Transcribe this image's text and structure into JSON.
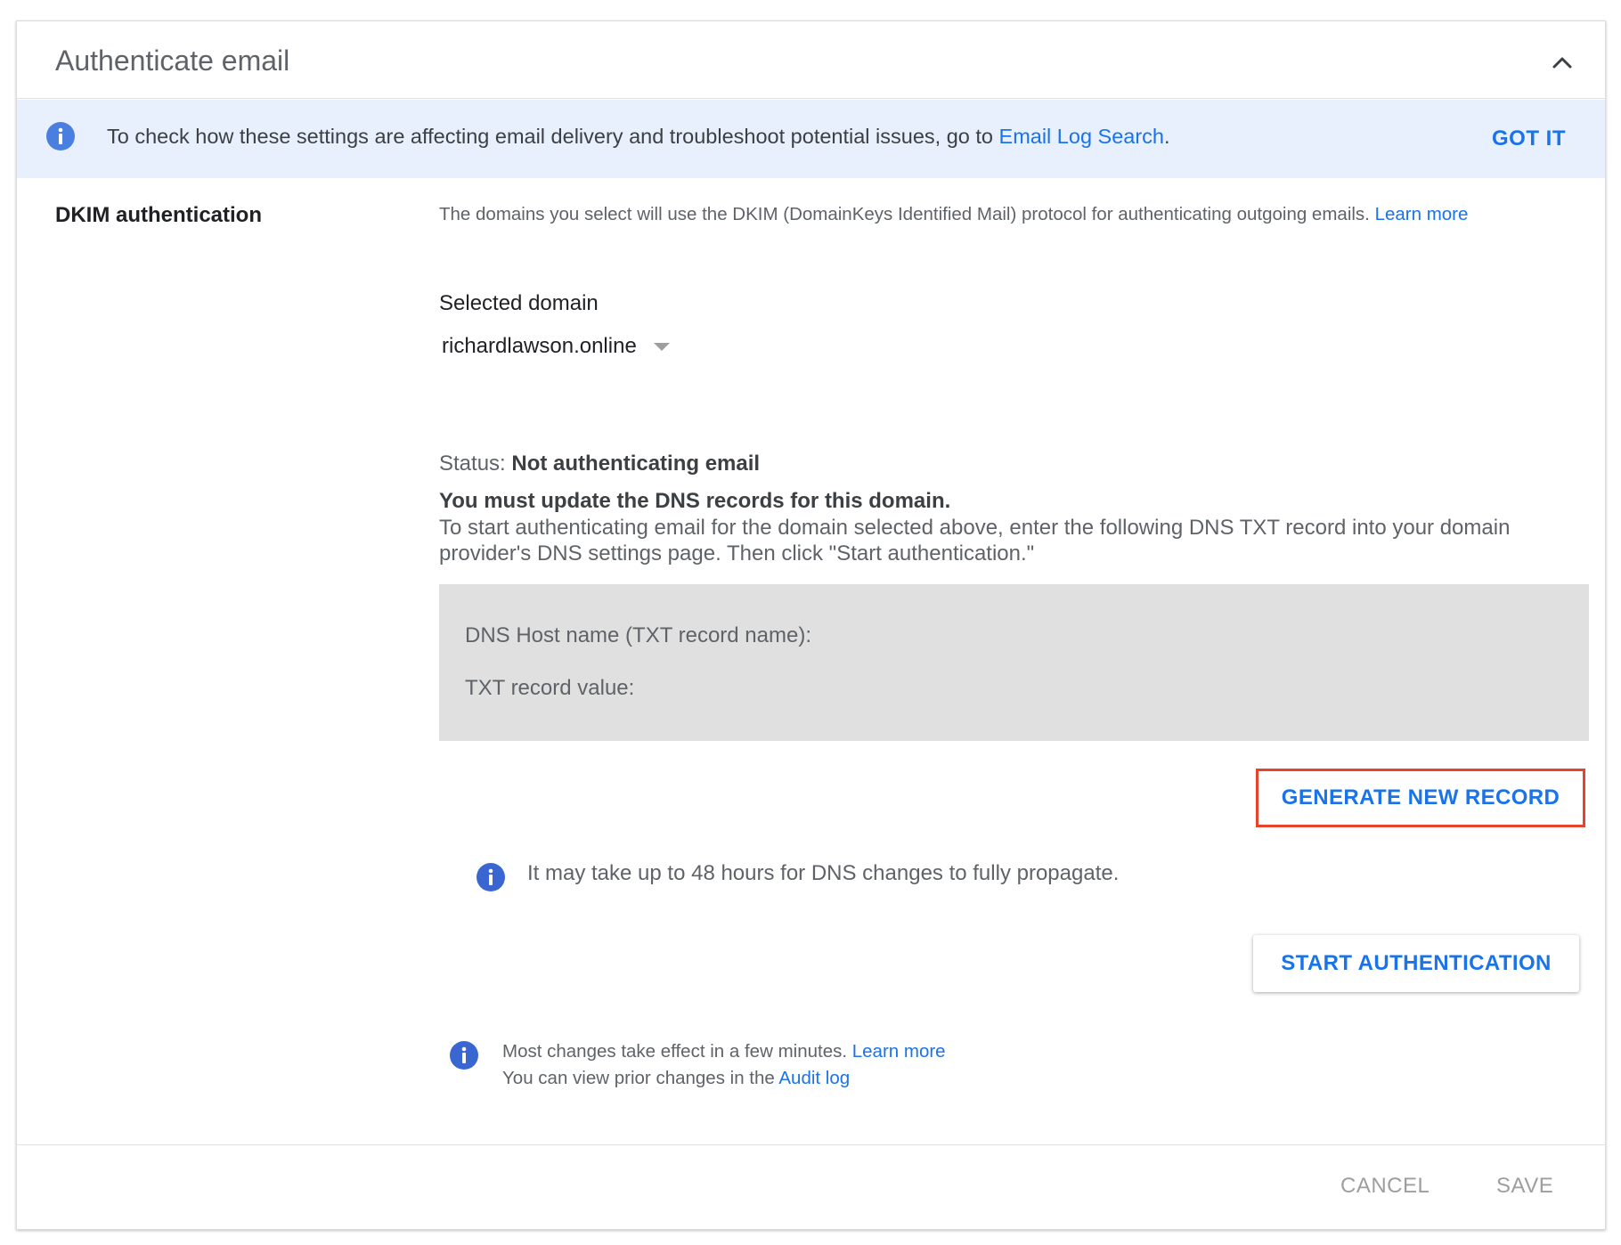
{
  "header": {
    "title": "Authenticate email",
    "collapse_icon": "chevron-up-icon"
  },
  "banner": {
    "icon": "info-icon",
    "text": "To check how these settings are affecting email delivery and troubleshoot potential issues, go to ",
    "link_text": "Email Log Search",
    "text_suffix": ".",
    "dismiss_label": "GOT IT"
  },
  "dkim": {
    "section_label": "DKIM authentication",
    "description": "The domains you select will use the DKIM (DomainKeys Identified Mail) protocol for authenticating outgoing emails. ",
    "learn_more": "Learn more",
    "selected_domain_label": "Selected domain",
    "selected_domain_value": "richardlawson.online",
    "status_prefix": "Status: ",
    "status_value": "Not authenticating email",
    "dns_warning": "You must update the DNS records for this domain.",
    "dns_instructions": "To start authenticating email for the domain selected above, enter the following DNS TXT record into your domain provider's DNS settings page. Then click \"Start authentication.\"",
    "record_host_label": "DNS Host name (TXT record name):",
    "record_value_label": "TXT record value:",
    "generate_button": "GENERATE NEW RECORD",
    "propagate_note": "It may take up to 48 hours for DNS changes to fully propagate.",
    "start_button": "START AUTHENTICATION"
  },
  "notes": {
    "line1": "Most changes take effect in a few minutes. ",
    "line1_link": "Learn more",
    "line2": "You can view prior changes in the ",
    "line2_link": "Audit log"
  },
  "footer": {
    "cancel_label": "CANCEL",
    "save_label": "SAVE"
  },
  "colors": {
    "accent": "#1a73e8",
    "banner_bg": "#e8f0fe",
    "highlight_border": "#e8432d",
    "record_bg": "#e0e0e0",
    "disabled_text": "#9e9e9e"
  }
}
